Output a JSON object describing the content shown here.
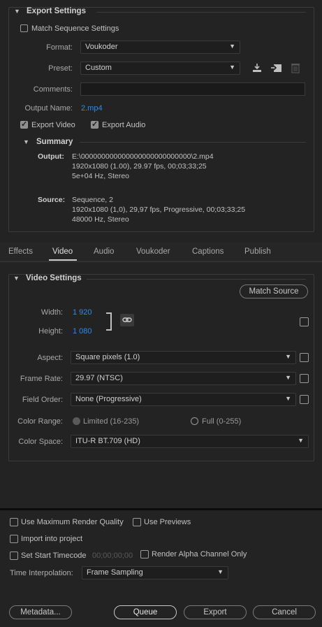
{
  "export_settings": {
    "title": "Export Settings",
    "match_sequence_label": "Match Sequence Settings",
    "format_label": "Format:",
    "format_value": "Voukoder",
    "preset_label": "Preset:",
    "preset_value": "Custom",
    "comments_label": "Comments:",
    "comments_value": "",
    "output_name_label": "Output Name:",
    "output_name_value": "2.mp4",
    "export_video_label": "Export Video",
    "export_video_checked": true,
    "export_audio_label": "Export Audio",
    "export_audio_checked": true
  },
  "summary": {
    "title": "Summary",
    "output_label": "Output:",
    "output_lines": [
      "E:\\000000000000000000000000000\\2.mp4",
      "1920x1080 (1.00), 29.97 fps, 00;03;33;25",
      "5e+04 Hz, Stereo"
    ],
    "source_label": "Source:",
    "source_lines": [
      "Sequence, 2",
      "1920x1080 (1,0), 29,97 fps, Progressive, 00;03;33;25",
      "48000 Hz, Stereo"
    ]
  },
  "tabs": [
    {
      "label": "Effects",
      "active": false
    },
    {
      "label": "Video",
      "active": true
    },
    {
      "label": "Audio",
      "active": false
    },
    {
      "label": "Voukoder",
      "active": false
    },
    {
      "label": "Captions",
      "active": false
    },
    {
      "label": "Publish",
      "active": false
    }
  ],
  "video_settings": {
    "title": "Video Settings",
    "match_source_label": "Match Source",
    "width_label": "Width:",
    "width_value": "1 920",
    "height_label": "Height:",
    "height_value": "1 080",
    "aspect_label": "Aspect:",
    "aspect_value": "Square pixels (1.0)",
    "frame_rate_label": "Frame Rate:",
    "frame_rate_value": "29.97 (NTSC)",
    "field_order_label": "Field Order:",
    "field_order_value": "None (Progressive)",
    "color_range_label": "Color Range:",
    "color_range_limited": "Limited (16-235)",
    "color_range_full": "Full (0-255)",
    "color_space_label": "Color Space:",
    "color_space_value": "ITU-R BT.709 (HD)"
  },
  "bottom": {
    "max_render_quality_label": "Use Maximum Render Quality",
    "use_previews_label": "Use Previews",
    "import_project_label": "Import into project",
    "set_start_timecode_label": "Set Start Timecode",
    "start_timecode_value": "00;00;00;00",
    "render_alpha_label": "Render Alpha Channel Only",
    "time_interpolation_label": "Time Interpolation:",
    "time_interpolation_value": "Frame Sampling"
  },
  "buttons": {
    "metadata": "Metadata...",
    "queue": "Queue",
    "export": "Export",
    "cancel": "Cancel"
  },
  "icons": {
    "save_preset": "download-icon",
    "import_preset": "import-icon",
    "delete_preset": "trash-icon",
    "link": "link-icon"
  },
  "colors": {
    "accent_blue": "#2d8ceb",
    "background": "#232323"
  }
}
